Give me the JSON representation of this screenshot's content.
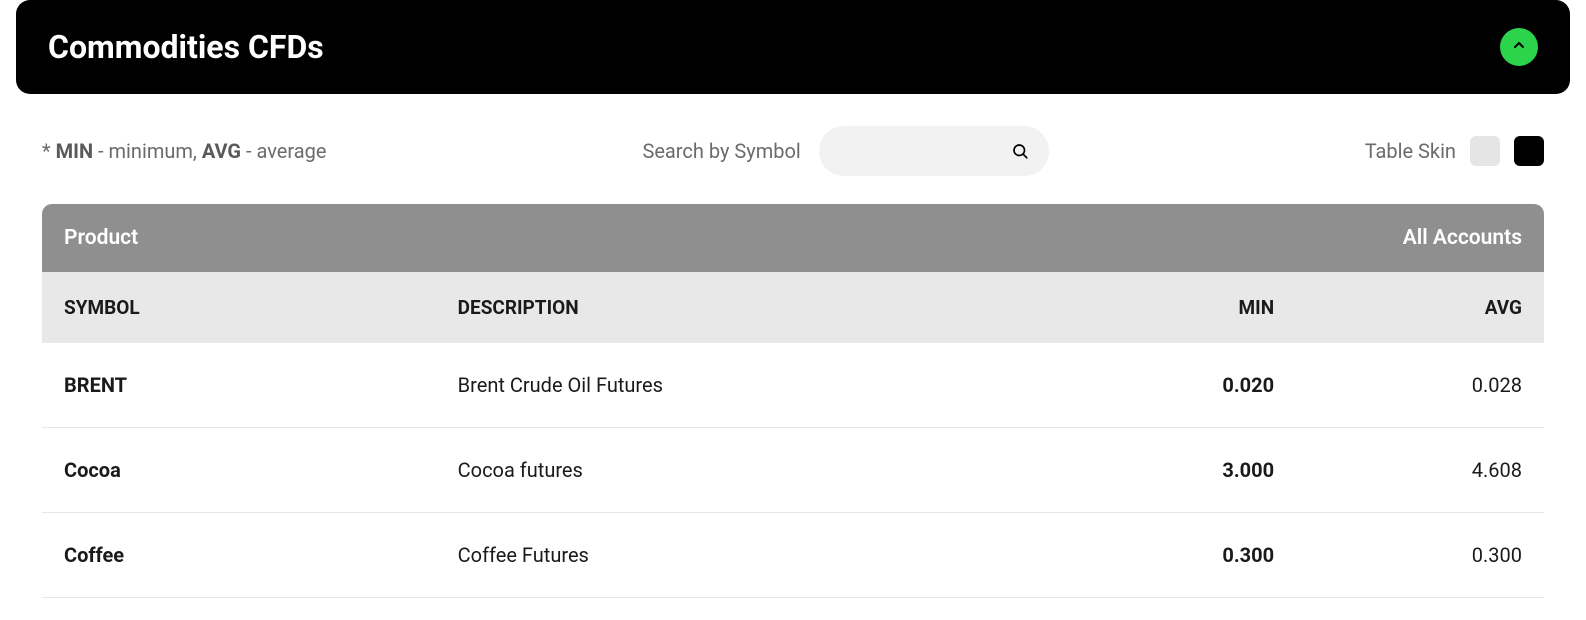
{
  "header": {
    "title": "Commodities CFDs"
  },
  "legend": {
    "prefix": "* ",
    "min_abbr": "MIN",
    "min_text": " - minimum, ",
    "avg_abbr": "AVG",
    "avg_text": " - average"
  },
  "search": {
    "label": "Search by Symbol",
    "placeholder": ""
  },
  "skin": {
    "label": "Table Skin"
  },
  "group_header": {
    "left": "Product",
    "right": "All Accounts"
  },
  "columns": {
    "symbol": "SYMBOL",
    "description": "DESCRIPTION",
    "min": "MIN",
    "avg": "AVG"
  },
  "rows": [
    {
      "symbol": "BRENT",
      "description": "Brent Crude Oil Futures",
      "min": "0.020",
      "avg": "0.028"
    },
    {
      "symbol": "Cocoa",
      "description": "Cocoa futures",
      "min": "3.000",
      "avg": "4.608"
    },
    {
      "symbol": "Coffee",
      "description": "Coffee Futures",
      "min": "0.300",
      "avg": "0.300"
    }
  ],
  "colors": {
    "accent_green": "#2bd44a"
  }
}
